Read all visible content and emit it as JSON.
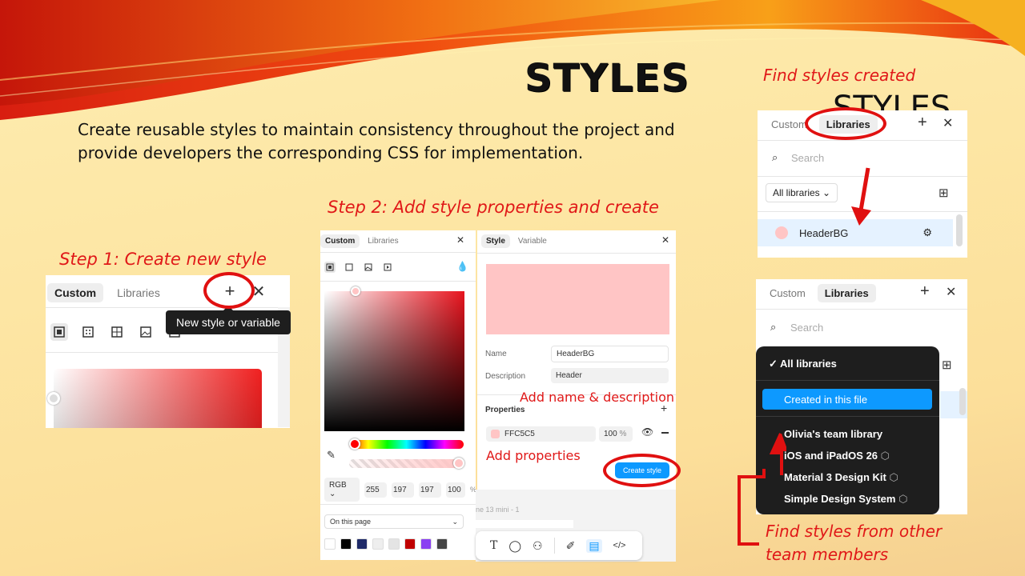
{
  "slide": {
    "title": "STYLES",
    "ghost_text": "STYLES",
    "subtitle": "Create reusable styles to maintain consistency throughout the project and provide developers the corresponding CSS for implementation."
  },
  "step1": {
    "label": "Step 1: Create new style",
    "tabs": [
      "Custom",
      "Libraries"
    ],
    "tooltip": "New style or variable"
  },
  "step2": {
    "label": "Step 2: Add style properties and create",
    "picker": {
      "tabs": [
        "Custom",
        "Libraries"
      ],
      "mode": "RGB",
      "r": "255",
      "g": "197",
      "b": "197",
      "alpha": "100",
      "pct": "%",
      "scope": "On this page",
      "swatches": [
        "#ffffff",
        "#000000",
        "#1f2a68",
        "#eeeeee",
        "#e4e4e4",
        "#c00000",
        "#8a3ff2",
        "#444444"
      ]
    },
    "style_panel": {
      "tabs": [
        "Style",
        "Variable"
      ],
      "preview_color": "#FFC5C5",
      "name_label": "Name",
      "name_value": "HeaderBG",
      "desc_label": "Description",
      "desc_value": "Header",
      "properties_label": "Properties",
      "color_hex": "FFC5C5",
      "opacity": "100",
      "pct": "%",
      "create_button": "Create style"
    },
    "annotation_name": "Add name & description",
    "annotation_props": "Add properties",
    "frame_fragment": "ne 13 mini - 1"
  },
  "find": {
    "label": "Find styles created",
    "tabs": [
      "Custom",
      "Libraries"
    ],
    "search_placeholder": "Search",
    "filter": "All libraries",
    "item_name": "HeaderBG",
    "item_color": "#FFC5C5"
  },
  "libs": {
    "tabs": [
      "Custom",
      "Libraries"
    ],
    "search_placeholder": "Search",
    "menu": {
      "all": "All libraries",
      "created": "Created in this file",
      "items": [
        "Olivia's team library",
        "iOS and iPadOS 26",
        "Material 3 Design Kit",
        "Simple Design System"
      ]
    },
    "annotation": "Find styles from other team members"
  },
  "colors": {
    "accent_red": "#e01818",
    "button_blue": "#0d99ff",
    "menu_bg": "#1e1e1e"
  }
}
